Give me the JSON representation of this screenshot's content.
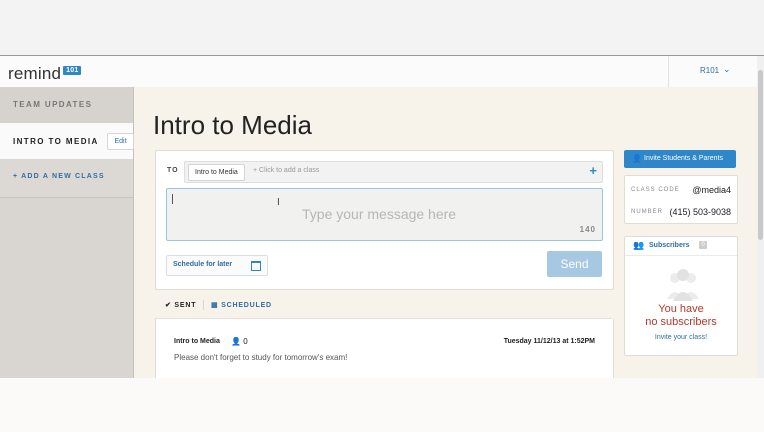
{
  "header": {
    "logo_text": "remind",
    "logo_badge": "101",
    "account_name": "R101",
    "account_caret": "⌄"
  },
  "sidebar": {
    "team_updates": "TEAM UPDATES",
    "active_class": "INTRO TO MEDIA",
    "edit_label": "Edit",
    "add_class": "+   ADD A NEW CLASS"
  },
  "page": {
    "title": "Intro to Media"
  },
  "composer": {
    "to_label": "TO",
    "to_chip": "Intro to Media",
    "to_hint": "+ Click to add a class",
    "to_plus": "+",
    "message_placeholder": "Type your message here",
    "char_count": "140",
    "schedule_label": "Schedule for later",
    "send_label": "Send"
  },
  "tabs": {
    "sent": "✔ SENT",
    "scheduled": "▦ SCHEDULED"
  },
  "message": {
    "class_name": "Intro to Media",
    "count_icon": "👤",
    "count": "0",
    "timestamp": "Tuesday 11/12/13 at 1:52PM",
    "body": "Please don't forget to study for tomorrow's exam!"
  },
  "right_panel": {
    "invite_button": "Invite Students & Parents",
    "class_code_label": "CLASS CODE",
    "class_code": "@media4",
    "number_label": "NUMBER",
    "number": "(415) 503-9038",
    "subscribers_title": "Subscribers",
    "subscribers_count": "0",
    "no_subscribers_line1": "You have",
    "no_subscribers_line2": "no subscribers",
    "invite_link": "Invite your class!"
  },
  "colors": {
    "accent": "#2e87c8",
    "send_disabled": "#a7c8e2",
    "empty_state": "#b23a2c"
  }
}
